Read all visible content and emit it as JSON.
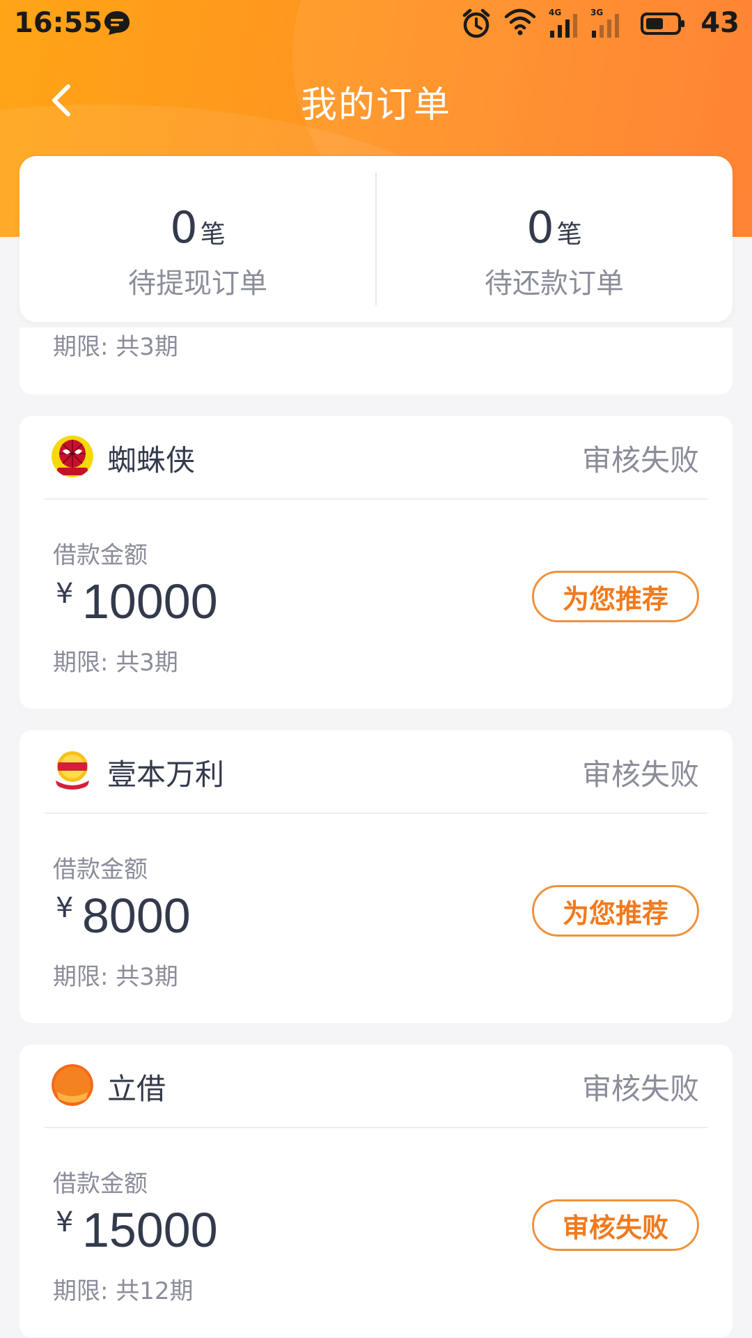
{
  "status_bar": {
    "time": "16:55",
    "battery": "43",
    "net_4g": "4G",
    "net_3g": "3G"
  },
  "nav": {
    "title": "我的订单"
  },
  "summary": {
    "pending_withdraw": {
      "count": "0",
      "unit": "笔",
      "label": "待提现订单"
    },
    "pending_repay": {
      "count": "0",
      "unit": "笔",
      "label": "待还款订单"
    }
  },
  "partial_card": {
    "period": "期限: 共3期"
  },
  "orders": [
    {
      "name": "蜘蛛侠",
      "status": "审核失败",
      "amount_label": "借款金额",
      "currency": "¥",
      "amount": "10000",
      "period": "期限: 共3期",
      "action": "为您推荐"
    },
    {
      "name": "壹本万利",
      "status": "审核失败",
      "amount_label": "借款金额",
      "currency": "¥",
      "amount": "8000",
      "period": "期限: 共3期",
      "action": "为您推荐"
    },
    {
      "name": "立借",
      "status": "审核失败",
      "amount_label": "借款金额",
      "currency": "¥",
      "amount": "15000",
      "period": "期限: 共12期",
      "action": "审核失败"
    }
  ],
  "logos": {
    "order_0": "spiderman-logo-icon",
    "order_1": "yiben-wanli-logo-icon",
    "order_2": "lijie-logo-icon"
  },
  "colors": {
    "header_start": "#ffa516",
    "header_end": "#ff7a26",
    "accent_orange": "#f07a1e",
    "text_dark": "#333a4c",
    "text_gray": "#8a8d99",
    "background": "#f5f5f7"
  }
}
